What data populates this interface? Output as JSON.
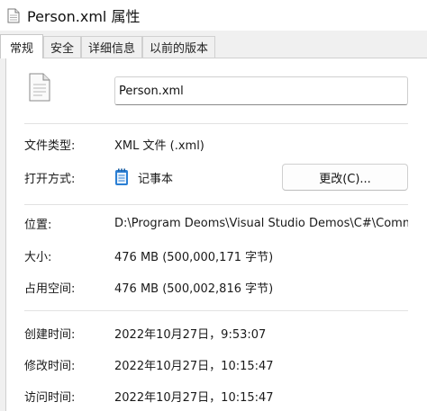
{
  "window": {
    "title": "Person.xml 属性"
  },
  "tabs": [
    {
      "label": "常规",
      "active": true
    },
    {
      "label": "安全",
      "active": false
    },
    {
      "label": "详细信息",
      "active": false
    },
    {
      "label": "以前的版本",
      "active": false
    }
  ],
  "general": {
    "file_name": "Person.xml",
    "file_type_label": "文件类型:",
    "file_type_value": "XML 文件 (.xml)",
    "open_with_label": "打开方式:",
    "open_with_value": "记事本",
    "change_button": "更改(C)...",
    "location_label": "位置:",
    "location_value": "D:\\Program Deoms\\Visual Studio Demos\\C#\\Commo",
    "size_label": "大小:",
    "size_value": "476 MB (500,000,171 字节)",
    "disk_size_label": "占用空间:",
    "disk_size_value": "476 MB (500,002,816 字节)",
    "created_label": "创建时间:",
    "created_value": "2022年10月27日，9:53:07",
    "modified_label": "修改时间:",
    "modified_value": "2022年10月27日，10:15:47",
    "accessed_label": "访问时间:",
    "accessed_value": "2022年10月27日，10:15:47"
  },
  "icons": {
    "title": "document-icon",
    "file": "document-icon",
    "open_with": "notepad-icon"
  },
  "colors": {
    "notepad_blue": "#2b7fd4"
  }
}
